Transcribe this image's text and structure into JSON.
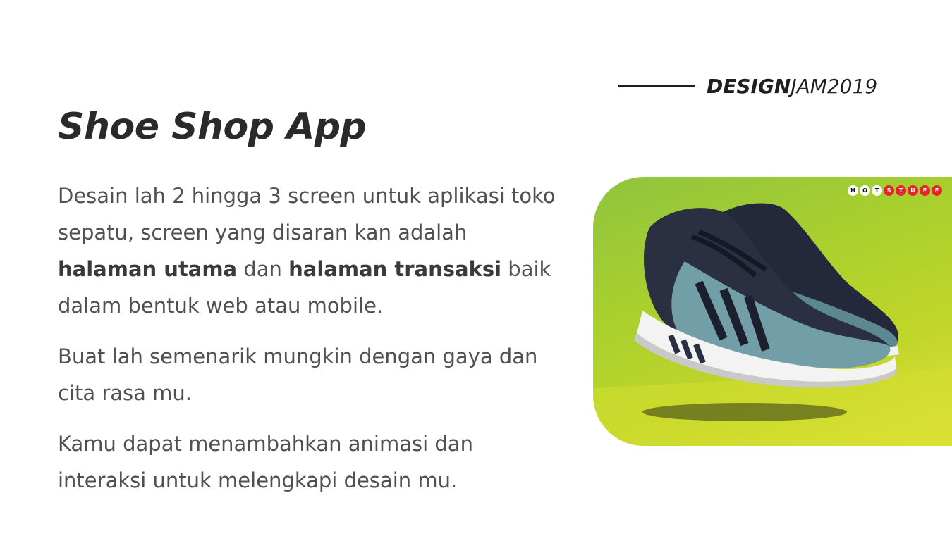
{
  "brand": {
    "bold": "DESIGN",
    "light": "JAM2019"
  },
  "title": "Shoe Shop App",
  "paragraphs": {
    "p1_line1": "Desain lah 2 hingga 3 screen untuk aplikasi toko sepatu, screen yang disaran kan adalah",
    "p1_bold1": "halaman utama",
    "p1_mid": "dan",
    "p1_bold2": "halaman transaksi",
    "p1_end": "baik dalam bentuk web atau mobile.",
    "p2": "Buat lah semenarik mungkin dengan gaya dan cita rasa mu.",
    "p3": "Kamu dapat menambahkan animasi dan interaksi untuk melengkapi desain mu."
  },
  "product_image": {
    "badge_letters": [
      "H",
      "O",
      "T",
      "S",
      "T",
      "U",
      "F",
      "F"
    ],
    "colors": {
      "bg_start": "#8fc43f",
      "bg_end": "#e4e33a",
      "shoe_upper": "#23283a",
      "shoe_knit": "#7fb1b8",
      "sole": "#f2f2f2",
      "badge_red": "#e3262b"
    }
  }
}
